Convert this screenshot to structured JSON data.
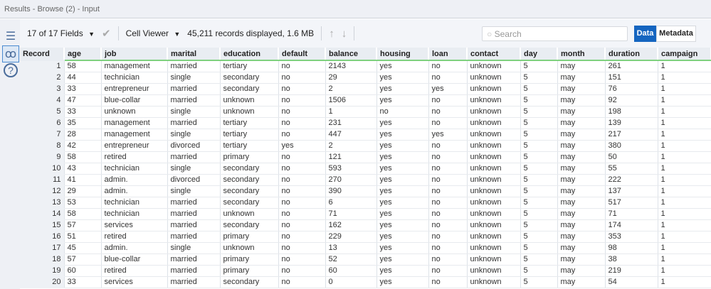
{
  "title": "Results - Browse (2) - Input",
  "toolbar": {
    "fields": "17 of 17 Fields",
    "viewer": "Cell Viewer",
    "records": "45,211 records displayed, 1.6 MB",
    "search_placeholder": "Search",
    "data_tab": "Data",
    "metadata_tab": "Metadata"
  },
  "columns": [
    "Record",
    "age",
    "job",
    "marital",
    "education",
    "default",
    "balance",
    "housing",
    "loan",
    "contact",
    "day",
    "month",
    "duration",
    "campaign"
  ],
  "rows": [
    [
      1,
      58,
      "management",
      "married",
      "tertiary",
      "no",
      2143,
      "yes",
      "no",
      "unknown",
      5,
      "may",
      261,
      1
    ],
    [
      2,
      44,
      "technician",
      "single",
      "secondary",
      "no",
      29,
      "yes",
      "no",
      "unknown",
      5,
      "may",
      151,
      1
    ],
    [
      3,
      33,
      "entrepreneur",
      "married",
      "secondary",
      "no",
      2,
      "yes",
      "yes",
      "unknown",
      5,
      "may",
      76,
      1
    ],
    [
      4,
      47,
      "blue-collar",
      "married",
      "unknown",
      "no",
      1506,
      "yes",
      "no",
      "unknown",
      5,
      "may",
      92,
      1
    ],
    [
      5,
      33,
      "unknown",
      "single",
      "unknown",
      "no",
      1,
      "no",
      "no",
      "unknown",
      5,
      "may",
      198,
      1
    ],
    [
      6,
      35,
      "management",
      "married",
      "tertiary",
      "no",
      231,
      "yes",
      "no",
      "unknown",
      5,
      "may",
      139,
      1
    ],
    [
      7,
      28,
      "management",
      "single",
      "tertiary",
      "no",
      447,
      "yes",
      "yes",
      "unknown",
      5,
      "may",
      217,
      1
    ],
    [
      8,
      42,
      "entrepreneur",
      "divorced",
      "tertiary",
      "yes",
      2,
      "yes",
      "no",
      "unknown",
      5,
      "may",
      380,
      1
    ],
    [
      9,
      58,
      "retired",
      "married",
      "primary",
      "no",
      121,
      "yes",
      "no",
      "unknown",
      5,
      "may",
      50,
      1
    ],
    [
      10,
      43,
      "technician",
      "single",
      "secondary",
      "no",
      593,
      "yes",
      "no",
      "unknown",
      5,
      "may",
      55,
      1
    ],
    [
      11,
      41,
      "admin.",
      "divorced",
      "secondary",
      "no",
      270,
      "yes",
      "no",
      "unknown",
      5,
      "may",
      222,
      1
    ],
    [
      12,
      29,
      "admin.",
      "single",
      "secondary",
      "no",
      390,
      "yes",
      "no",
      "unknown",
      5,
      "may",
      137,
      1
    ],
    [
      13,
      53,
      "technician",
      "married",
      "secondary",
      "no",
      6,
      "yes",
      "no",
      "unknown",
      5,
      "may",
      517,
      1
    ],
    [
      14,
      58,
      "technician",
      "married",
      "unknown",
      "no",
      71,
      "yes",
      "no",
      "unknown",
      5,
      "may",
      71,
      1
    ],
    [
      15,
      57,
      "services",
      "married",
      "secondary",
      "no",
      162,
      "yes",
      "no",
      "unknown",
      5,
      "may",
      174,
      1
    ],
    [
      16,
      51,
      "retired",
      "married",
      "primary",
      "no",
      229,
      "yes",
      "no",
      "unknown",
      5,
      "may",
      353,
      1
    ],
    [
      17,
      45,
      "admin.",
      "single",
      "unknown",
      "no",
      13,
      "yes",
      "no",
      "unknown",
      5,
      "may",
      98,
      1
    ],
    [
      18,
      57,
      "blue-collar",
      "married",
      "primary",
      "no",
      52,
      "yes",
      "no",
      "unknown",
      5,
      "may",
      38,
      1
    ],
    [
      19,
      60,
      "retired",
      "married",
      "primary",
      "no",
      60,
      "yes",
      "no",
      "unknown",
      5,
      "may",
      219,
      1
    ],
    [
      20,
      33,
      "services",
      "married",
      "secondary",
      "no",
      0,
      "yes",
      "no",
      "unknown",
      5,
      "may",
      54,
      1
    ]
  ]
}
